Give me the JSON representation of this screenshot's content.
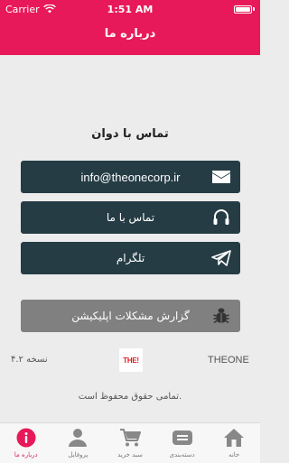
{
  "status_bar": {
    "carrier": "Carrier",
    "time": "1:51 AM"
  },
  "header": {
    "title": "درباره ما"
  },
  "section": {
    "title": "تماس با دوان"
  },
  "buttons": {
    "email": "info@theonecorp.ir",
    "contact": "تماس با ما",
    "telegram": "تلگرام",
    "report": "گزارش مشکلات اپلیکیشن"
  },
  "footer_info": {
    "brand": "THEONE",
    "logo_text": "THE!",
    "version": "نسخه ۴.۲",
    "copyright": "تمامی حقوق محفوظ است."
  },
  "tabs": [
    {
      "label": "درباره ما",
      "icon": "info-icon",
      "active": true
    },
    {
      "label": "پروفایل",
      "icon": "user-icon",
      "active": false
    },
    {
      "label": "سبد خرید",
      "icon": "cart-icon",
      "active": false
    },
    {
      "label": "دسته‌بندی",
      "icon": "category-icon",
      "active": false
    },
    {
      "label": "خانه",
      "icon": "home-icon",
      "active": false
    }
  ],
  "colors": {
    "accent": "#e8195a",
    "button": "#253c45",
    "report_button": "#808080",
    "background": "#ececec"
  }
}
